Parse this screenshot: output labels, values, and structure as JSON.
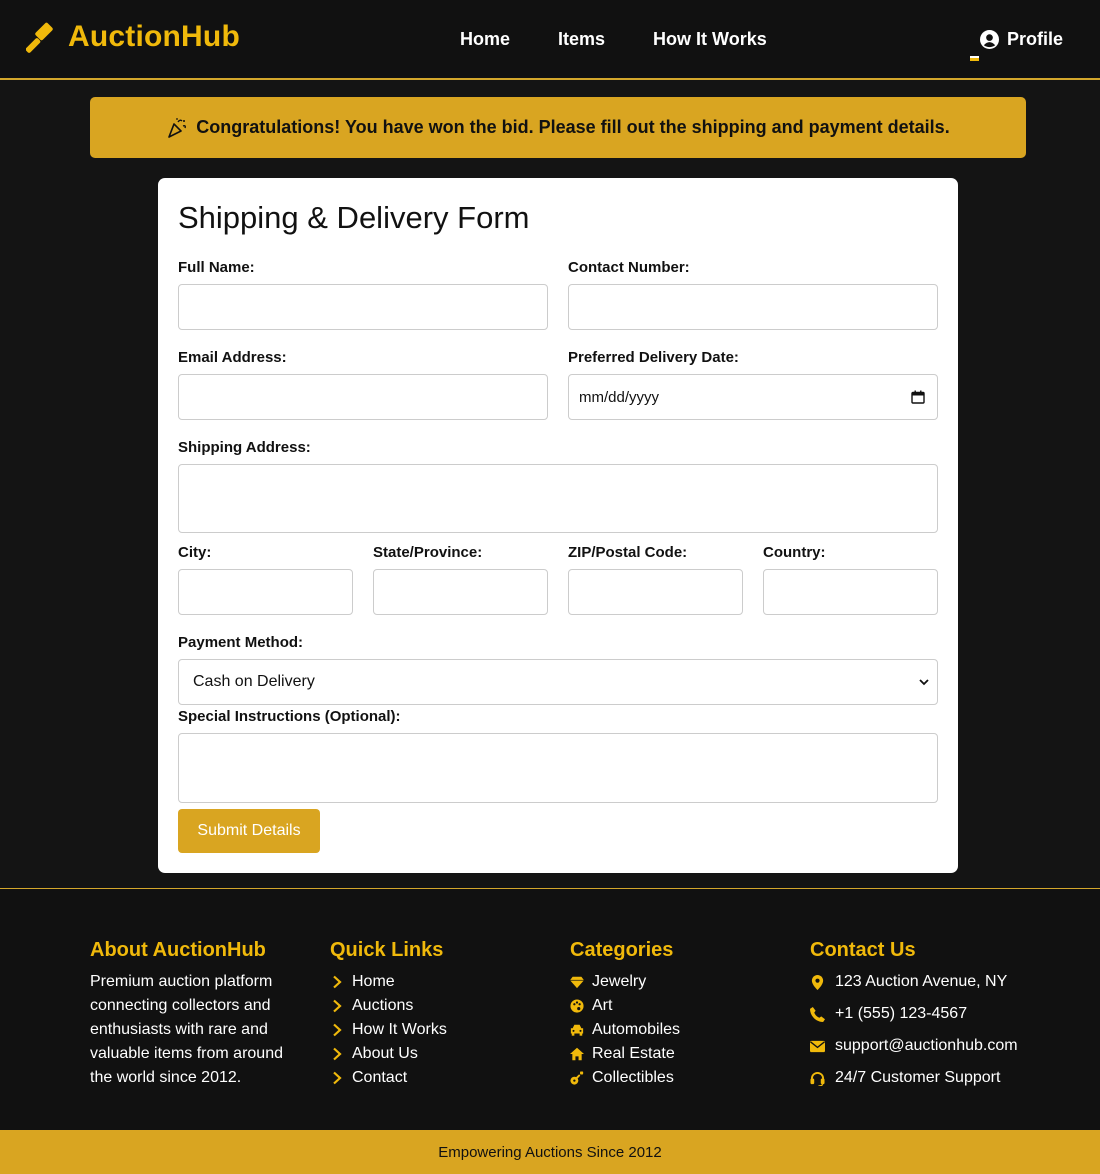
{
  "nav": {
    "brand": "AuctionHub",
    "links": [
      "Home",
      "Items",
      "How It Works"
    ],
    "profile_label": "Profile",
    "accent": "#f0b90b"
  },
  "banner": {
    "text": "Congratulations! You have won the bid. Please fill out the shipping and payment details.",
    "icon": "party-popper-icon"
  },
  "form": {
    "title": "Shipping & Delivery Form",
    "full_name_label": "Full Name:",
    "contact_number_label": "Contact Number:",
    "email_label": "Email Address:",
    "delivery_date_label": "Preferred Delivery Date:",
    "delivery_date_placeholder": "mm/dd/yyyy",
    "shipping_address_label": "Shipping Address:",
    "city_label": "City:",
    "state_label": "State/Province:",
    "zip_label": "ZIP/Postal Code:",
    "country_label": "Country:",
    "payment_label": "Payment Method:",
    "payment_selected": "Cash on Delivery",
    "instructions_label": "Special Instructions (Optional):",
    "submit_label": "Submit Details"
  },
  "footer": {
    "about": {
      "title": "About AuctionHub",
      "text": "Premium auction platform connecting collectors and enthusiasts with rare and valuable items from around the world since 2012."
    },
    "quick_links": {
      "title": "Quick Links",
      "items": [
        "Home",
        "Auctions",
        "How It Works",
        "About Us",
        "Contact"
      ]
    },
    "categories": {
      "title": "Categories",
      "items": [
        "Jewelry",
        "Art",
        "Automobiles",
        "Real Estate",
        "Collectibles"
      ]
    },
    "contact": {
      "title": "Contact Us",
      "items": [
        "123 Auction Avenue, NY",
        "+1 (555) 123-4567",
        "support@auctionhub.com",
        "24/7 Customer Support"
      ]
    },
    "tagline": "Empowering Auctions Since 2012"
  }
}
